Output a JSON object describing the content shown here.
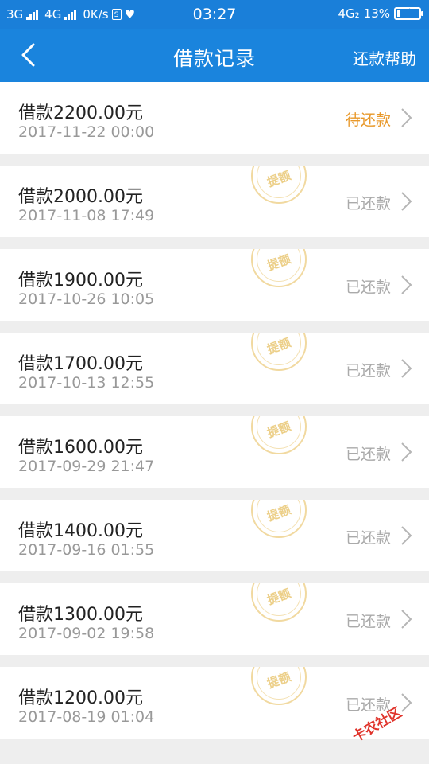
{
  "status_bar": {
    "left_net1": "3G",
    "left_net2": "4G",
    "speed": "0K/s",
    "sim_label": "S",
    "time": "03:27",
    "right_net": "4G₂",
    "battery": "13%",
    "battery_level": 0.13
  },
  "nav": {
    "title": "借款记录",
    "help": "还款帮助"
  },
  "stamp_label": "提额",
  "records": [
    {
      "amount": "借款2200.00元",
      "date": "2017-11-22 00:00",
      "status": "待还款",
      "pending": true
    },
    {
      "amount": "借款2000.00元",
      "date": "2017-11-08 17:49",
      "status": "已还款",
      "pending": false
    },
    {
      "amount": "借款1900.00元",
      "date": "2017-10-26 10:05",
      "status": "已还款",
      "pending": false
    },
    {
      "amount": "借款1700.00元",
      "date": "2017-10-13 12:55",
      "status": "已还款",
      "pending": false
    },
    {
      "amount": "借款1600.00元",
      "date": "2017-09-29 21:47",
      "status": "已还款",
      "pending": false
    },
    {
      "amount": "借款1400.00元",
      "date": "2017-09-16 01:55",
      "status": "已还款",
      "pending": false
    },
    {
      "amount": "借款1300.00元",
      "date": "2017-09-02 19:58",
      "status": "已还款",
      "pending": false
    },
    {
      "amount": "借款1200.00元",
      "date": "2017-08-19 01:04",
      "status": "已还款",
      "pending": false
    }
  ],
  "watermark": "卡农社区",
  "colors": {
    "nav_bg": "#1a84dd",
    "pending": "#e8982a",
    "repaid": "#aaaaaa"
  }
}
